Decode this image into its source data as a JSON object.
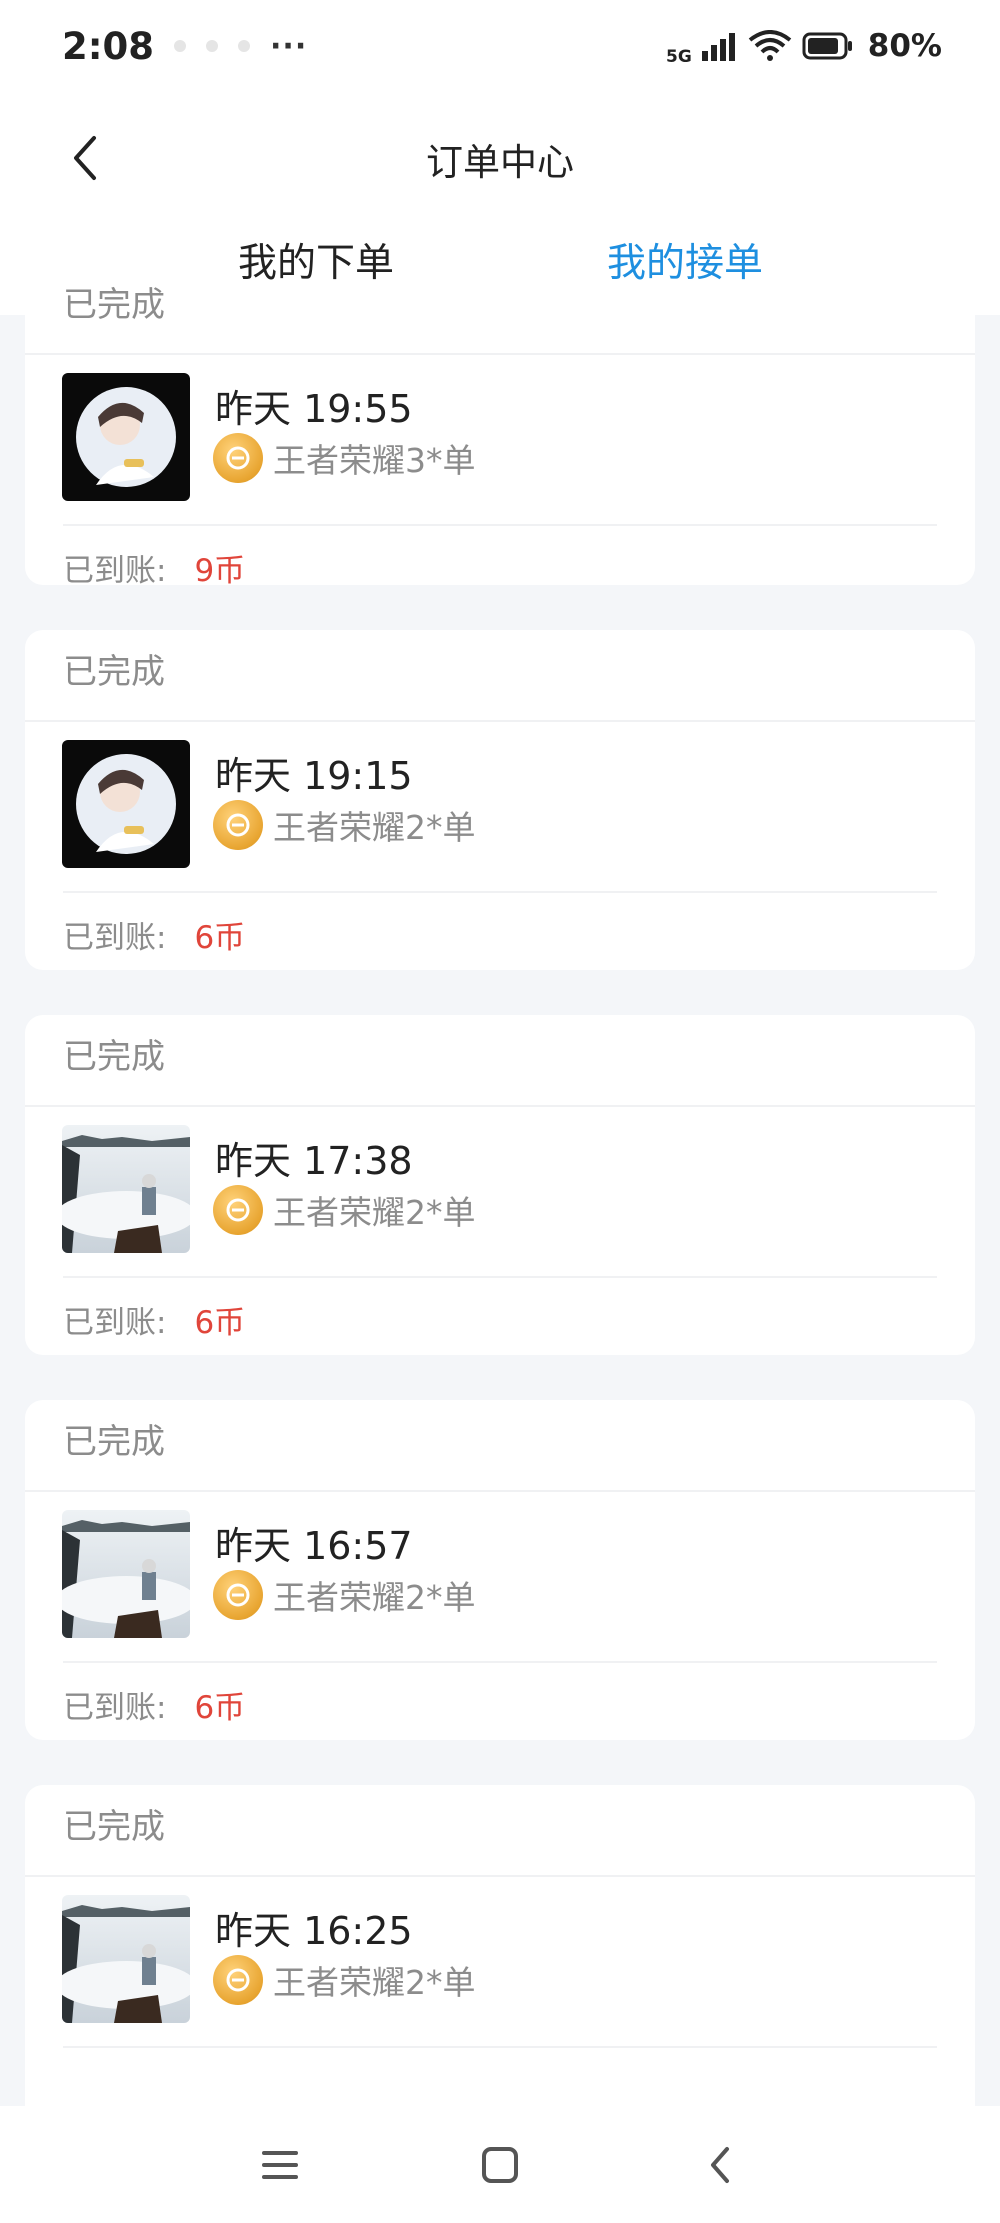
{
  "status_bar": {
    "time": "2:08",
    "more": "···",
    "network": "5G",
    "battery": "80%"
  },
  "header": {
    "title": "订单中心",
    "tabs": [
      {
        "label": "我的下单",
        "active": false
      },
      {
        "label": "我的接单",
        "active": true
      }
    ]
  },
  "orders": [
    {
      "status": "已完成",
      "time": "昨天 19:55",
      "game": "王者荣耀3*单",
      "pay_label": "已到账:",
      "amount": "9币",
      "thumb": "portrait"
    },
    {
      "status": "已完成",
      "time": "昨天 19:15",
      "game": "王者荣耀2*单",
      "pay_label": "已到账:",
      "amount": "6币",
      "thumb": "portrait"
    },
    {
      "status": "已完成",
      "time": "昨天 17:38",
      "game": "王者荣耀2*单",
      "pay_label": "已到账:",
      "amount": "6币",
      "thumb": "landscape"
    },
    {
      "status": "已完成",
      "time": "昨天 16:57",
      "game": "王者荣耀2*单",
      "pay_label": "已到账:",
      "amount": "6币",
      "thumb": "landscape"
    },
    {
      "status": "已完成",
      "time": "昨天 16:25",
      "game": "王者荣耀2*单",
      "pay_label": "",
      "amount": "",
      "thumb": "landscape"
    }
  ],
  "colors": {
    "accent": "#1e8fe0",
    "amount": "#e0453a",
    "muted": "#8c8c8c"
  },
  "icons": [
    "back-arrow-icon",
    "game-coin-icon",
    "menu-icon",
    "home-icon",
    "nav-back-icon"
  ]
}
